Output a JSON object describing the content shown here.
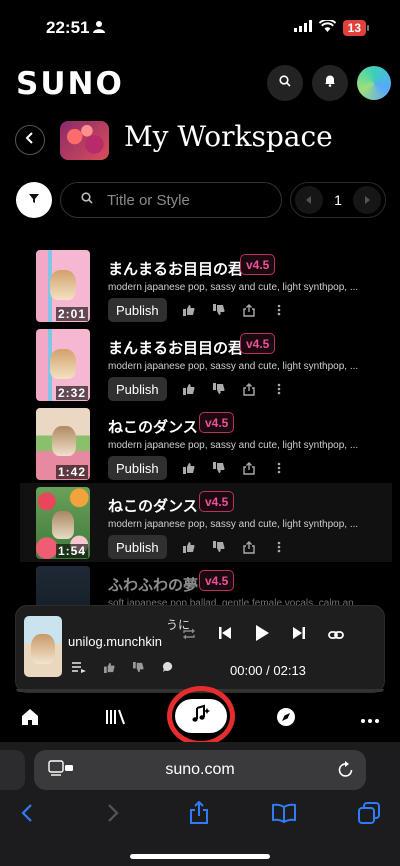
{
  "status": {
    "time": "22:51",
    "battery": "13"
  },
  "app": {
    "logo": "SUNO"
  },
  "workspace": {
    "title": "My Workspace"
  },
  "search": {
    "placeholder": "Title or Style",
    "value": ""
  },
  "pagination": {
    "page": "1"
  },
  "songs": [
    {
      "title": "まんまるお目目の君",
      "version": "v4.5",
      "style": "modern japanese pop, sassy and cute, light synthpop, ...",
      "duration": "2:01",
      "publish": "Publish"
    },
    {
      "title": "まんまるお目目の君",
      "version": "v4.5",
      "style": "modern japanese pop, sassy and cute, light synthpop, ...",
      "duration": "2:32",
      "publish": "Publish"
    },
    {
      "title": "ねこのダンス",
      "version": "v4.5",
      "style": "modern japanese pop, sassy and cute, light synthpop, ...",
      "duration": "1:42",
      "publish": "Publish"
    },
    {
      "title": "ねこのダンス",
      "version": "v4.5",
      "style": "modern japanese pop, sassy and cute, light synthpop, ...",
      "duration": "1:54",
      "publish": "Publish"
    },
    {
      "title": "ふわふわの夢",
      "version": "v4.5",
      "style": "soft japanese pop ballad, gentle female vocals, calm an"
    }
  ],
  "player": {
    "title": "うに",
    "artist": "unilog.munchkin",
    "time": "00:00 / 02:13"
  },
  "browser": {
    "url": "suno.com"
  },
  "colors": {
    "accent_badge": "#f0509a",
    "highlight_ring": "#e52d2d",
    "safari_blue": "#2f7cf6"
  }
}
